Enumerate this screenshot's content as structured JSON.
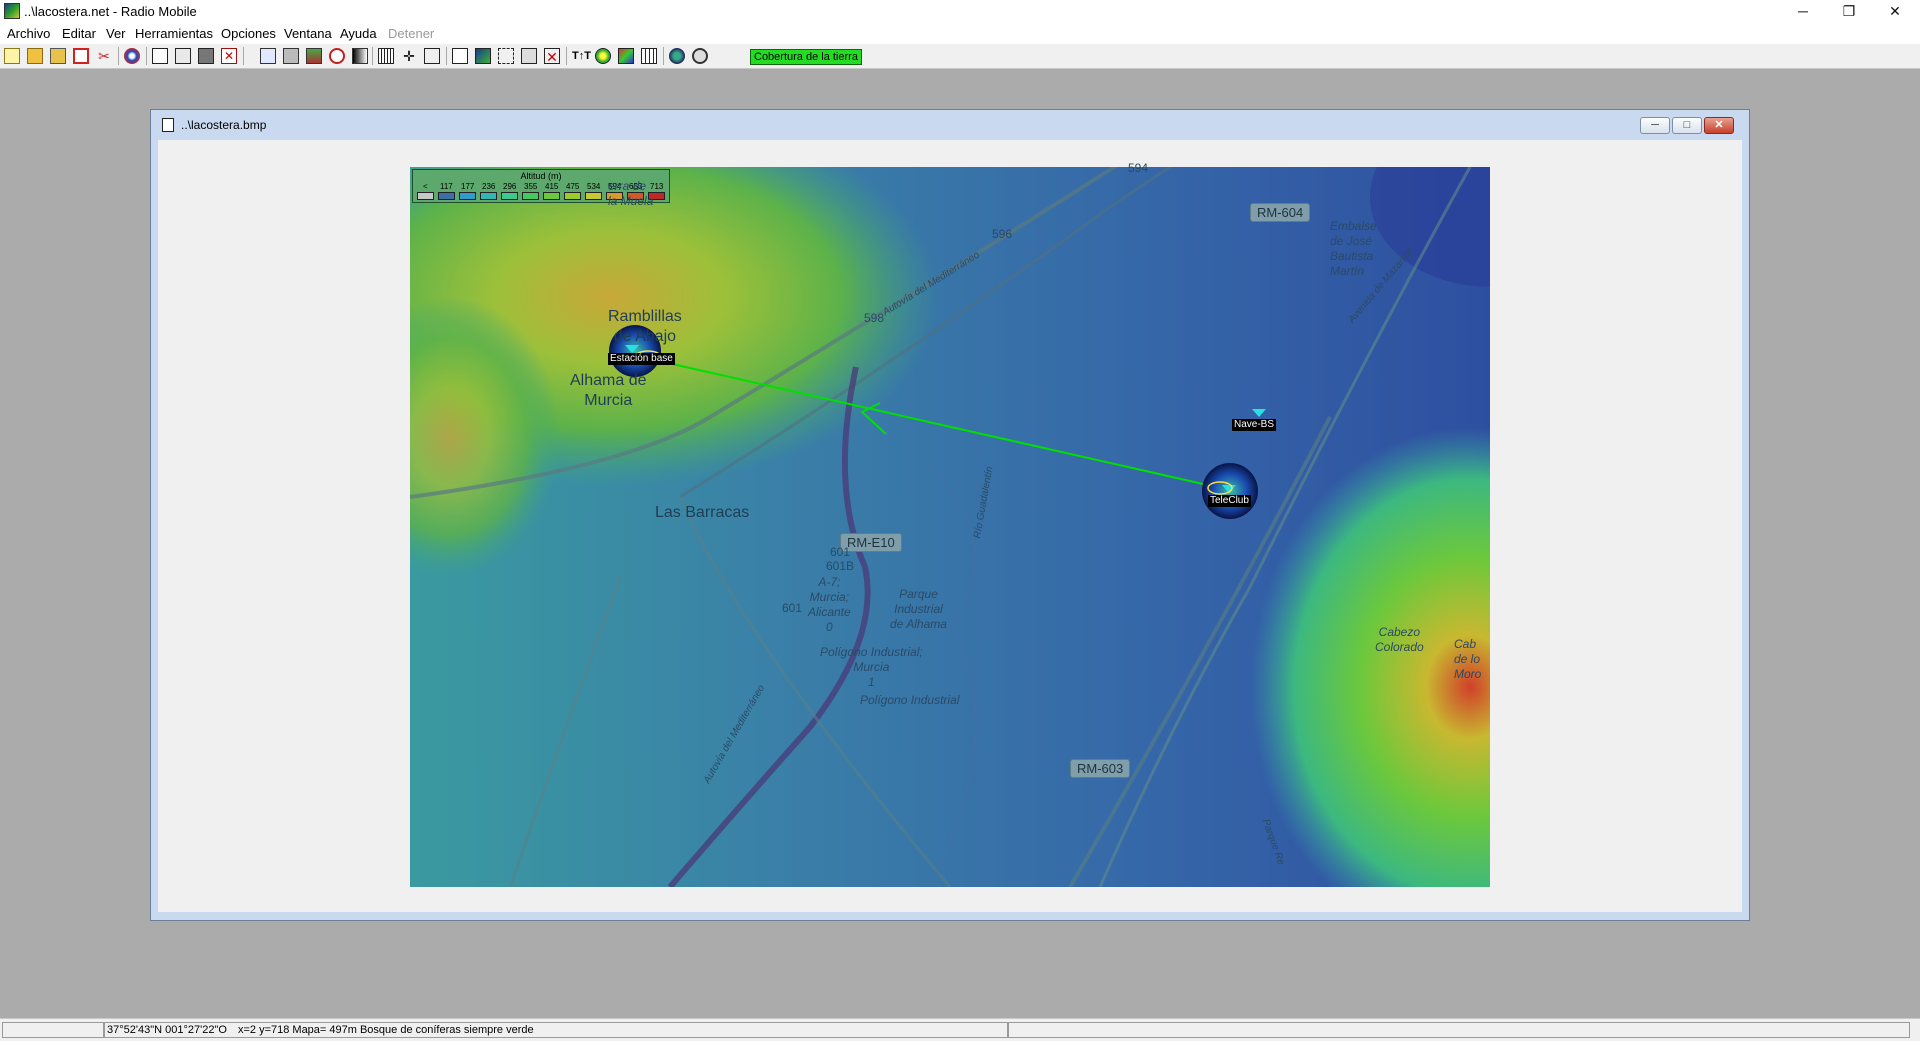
{
  "window": {
    "title": "..\\lacostera.net - Radio Mobile",
    "minimize": "─",
    "restore": "❐",
    "close": "✕"
  },
  "menu": [
    "Archivo",
    "Editar",
    "Ver",
    "Herramientas",
    "Opciones",
    "Ventana",
    "Ayuda",
    "Detener"
  ],
  "toolbar": {
    "icons": [
      "new-icon",
      "open-icon",
      "save-all-icon",
      "network-properties-icon",
      "cut-icon",
      "globe-icon",
      "map-properties-icon",
      "merge-icon",
      "save-picture-icon",
      "close-picture-icon",
      "copy-icon",
      "print-icon",
      "elevation-icon",
      "compass-icon",
      "grayscale-icon",
      "ruler-icon",
      "crosshair-icon",
      "photo-icon",
      "window-icon",
      "google-icon",
      "fit-icon",
      "zoom-icon",
      "delete-icon",
      "radio-link-icon",
      "polar-icon",
      "cartesian-icon",
      "route-icon",
      "world-icon",
      "settings-icon"
    ],
    "coverage_button": "Cobertura de la tierra"
  },
  "child_window": {
    "title": "..\\lacostera.bmp",
    "minimize": "─",
    "restore": "□",
    "close": "✕"
  },
  "legend": {
    "title": "Altitud (m)",
    "labels": [
      "<",
      "117",
      "177",
      "236",
      "296",
      "355",
      "415",
      "475",
      "534",
      "594",
      "653",
      "713"
    ],
    "colors": [
      "#c8c8c8",
      "#3a6fa8",
      "#2f9ccc",
      "#32b8b4",
      "#3cc88f",
      "#48c85c",
      "#6cc83c",
      "#9ccc2c",
      "#c8c832",
      "#d89a2a",
      "#d05a28",
      "#c02828"
    ]
  },
  "map": {
    "place_labels": {
      "ramblillas": "Ramblillas\nde Abajo",
      "alhama": "Alhama de\nMurcia",
      "las_barracas": "Las Barracas",
      "sierra": "erra de\nla Muela",
      "embalse": "Embalse\nde José\nBautista\nMartín",
      "parque_industrial": "Parque\nIndustrial\nde Alhama",
      "poligono1": "Polígono Industrial;\nMurcia\n1",
      "poligono2": "Polígono Industrial",
      "a7": "A-7;\nMurcia;\nAlicante\n0",
      "cabezo": "Cabezo\nColorado",
      "cabezo2": "Cab\nde lo\nMoro",
      "rio": "Río Guadalentín",
      "autovia1": "Autovía del Mediterráneo",
      "autovia2": "Autovía del Mediterráneo",
      "avenida": "Avenida de Mazarrón",
      "parque_re": "Parque Re"
    },
    "road_badges": {
      "rm604": "RM-604",
      "rme10": "RM-E10",
      "rm603": "RM-603"
    },
    "road_numbers": {
      "n594": "594",
      "n596": "596",
      "n598": "598",
      "n601": "601",
      "n601b": "601B",
      "n601c": "601"
    },
    "sites": {
      "base": "Estación base",
      "nave": "Nave-BS",
      "teleclub": "TeleClub"
    }
  },
  "statusbar": {
    "coords": "37°52'43\"N  001°27'22\"O",
    "info": "x=2 y=718 Mapa= 497m Bosque de coníferas siempre verde"
  }
}
